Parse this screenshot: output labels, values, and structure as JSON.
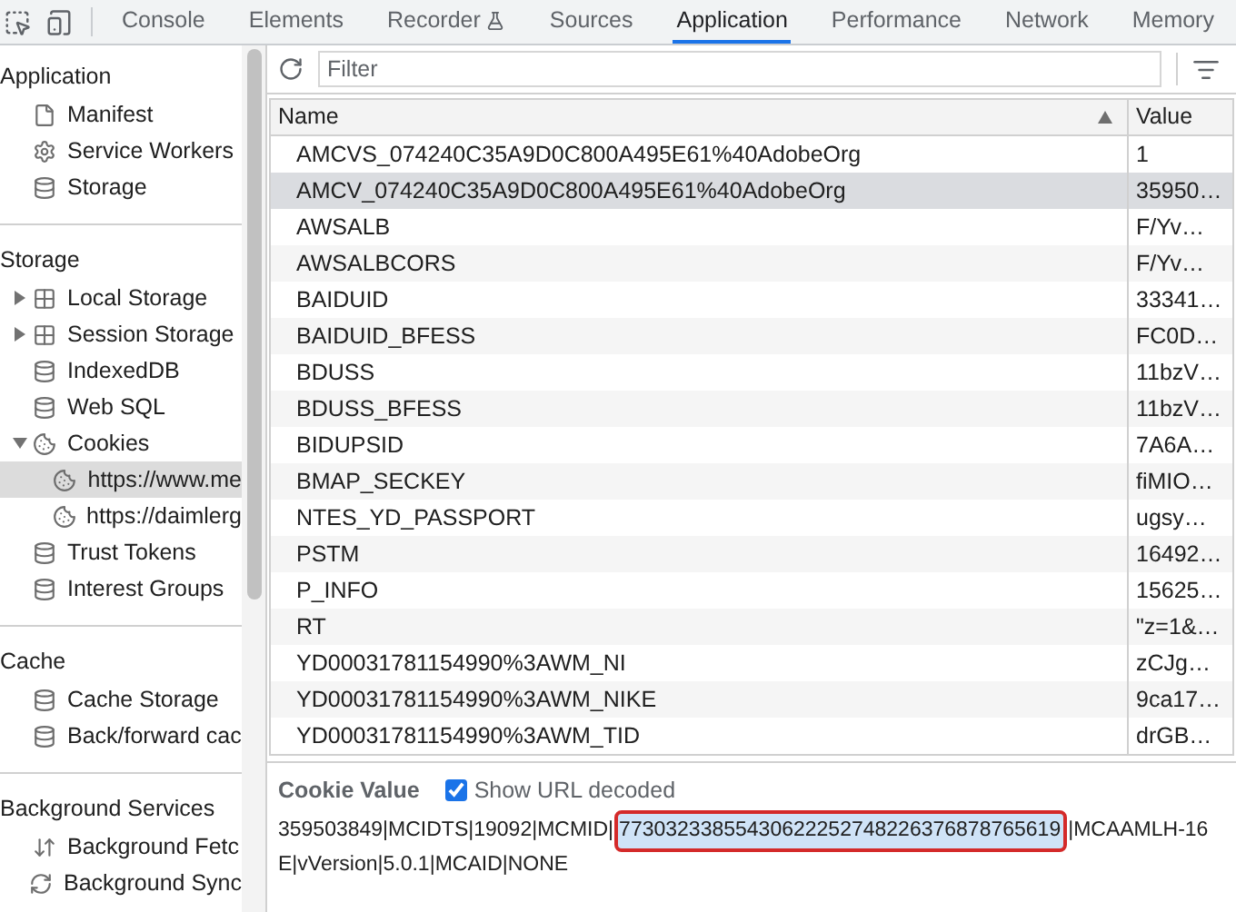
{
  "tabs": [
    {
      "label": "Console",
      "selected": false,
      "kind": "plain"
    },
    {
      "label": "Elements",
      "selected": false,
      "kind": "plain"
    },
    {
      "label": "Recorder",
      "selected": false,
      "kind": "flask"
    },
    {
      "label": "Sources",
      "selected": false,
      "kind": "plain"
    },
    {
      "label": "Application",
      "selected": true,
      "kind": "plain"
    },
    {
      "label": "Performance",
      "selected": false,
      "kind": "plain"
    },
    {
      "label": "Network",
      "selected": false,
      "kind": "plain"
    },
    {
      "label": "Memory",
      "selected": false,
      "kind": "plain"
    }
  ],
  "sidebar": {
    "sections": [
      {
        "title": "Application",
        "items": [
          {
            "label": "Manifest",
            "kind": "file",
            "selected": false
          },
          {
            "label": "Service Workers",
            "kind": "gear",
            "selected": false
          },
          {
            "label": "Storage",
            "kind": "database",
            "selected": false
          }
        ]
      },
      {
        "title": "Storage",
        "items": [
          {
            "label": "Local Storage",
            "kind": "grid",
            "expanded": false,
            "selected": false
          },
          {
            "label": "Session Storage",
            "kind": "grid",
            "expanded": false,
            "selected": false
          },
          {
            "label": "IndexedDB",
            "kind": "database",
            "selected": false
          },
          {
            "label": "Web SQL",
            "kind": "database",
            "selected": false
          },
          {
            "label": "Cookies",
            "kind": "cookie",
            "expanded": true,
            "selected": false,
            "children": [
              {
                "label": "https://www.me",
                "kind": "cookie",
                "selected": true
              },
              {
                "label": "https://daimlerg",
                "kind": "cookie",
                "selected": false
              }
            ]
          },
          {
            "label": "Trust Tokens",
            "kind": "database",
            "selected": false
          },
          {
            "label": "Interest Groups",
            "kind": "database",
            "selected": false
          }
        ]
      },
      {
        "title": "Cache",
        "items": [
          {
            "label": "Cache Storage",
            "kind": "database",
            "selected": false
          },
          {
            "label": "Back/forward cac",
            "kind": "database",
            "selected": false
          }
        ]
      },
      {
        "title": "Background Services",
        "items": [
          {
            "label": "Background Fetc",
            "kind": "arrows",
            "selected": false
          },
          {
            "label": "Background Sync",
            "kind": "sync",
            "selected": false
          }
        ]
      }
    ]
  },
  "toolbar": {
    "filter": {
      "placeholder": "Filter"
    }
  },
  "table": {
    "columns": [
      {
        "label": "Name",
        "sorted": true
      },
      {
        "label": "Value",
        "sorted": false
      }
    ],
    "rows": [
      {
        "name": "AMCVS_074240C35A9D0C800A495E61%40AdobeOrg",
        "value": "1",
        "selected": false
      },
      {
        "name": "AMCV_074240C35A9D0C800A495E61%40AdobeOrg",
        "value": "35950…",
        "selected": true
      },
      {
        "name": "AWSALB",
        "value": "F/Yv…",
        "selected": false
      },
      {
        "name": "AWSALBCORS",
        "value": "F/Yv…",
        "selected": false
      },
      {
        "name": "BAIDUID",
        "value": "33341…",
        "selected": false
      },
      {
        "name": "BAIDUID_BFESS",
        "value": "FC0D…",
        "selected": false
      },
      {
        "name": "BDUSS",
        "value": "11bzV…",
        "selected": false
      },
      {
        "name": "BDUSS_BFESS",
        "value": "11bzV…",
        "selected": false
      },
      {
        "name": "BIDUPSID",
        "value": "7A6A…",
        "selected": false
      },
      {
        "name": "BMAP_SECKEY",
        "value": "fiMIO…",
        "selected": false
      },
      {
        "name": "NTES_YD_PASSPORT",
        "value": "ugsy…",
        "selected": false
      },
      {
        "name": "PSTM",
        "value": "16492…",
        "selected": false
      },
      {
        "name": "P_INFO",
        "value": "15625…",
        "selected": false
      },
      {
        "name": "RT",
        "value": "\"z=1&…",
        "selected": false
      },
      {
        "name": "YD00031781154990%3AWM_NI",
        "value": "zCJg…",
        "selected": false
      },
      {
        "name": "YD00031781154990%3AWM_NIKE",
        "value": "9ca17…",
        "selected": false
      },
      {
        "name": "YD00031781154990%3AWM_TID",
        "value": "drGB…",
        "selected": false
      }
    ]
  },
  "cookie_value": {
    "title": "Cookie Value",
    "show_url_decoded": {
      "label": "Show URL decoded",
      "checked": true
    },
    "text_before": "359503849|MCIDTS|19092|MCMID|",
    "text_selected": "77303233855430622252748226376878765619",
    "text_after": "|MCAAMLH-16",
    "line_2": "E|vVersion|5.0.1|MCAID|NONE",
    "annotation": true
  }
}
